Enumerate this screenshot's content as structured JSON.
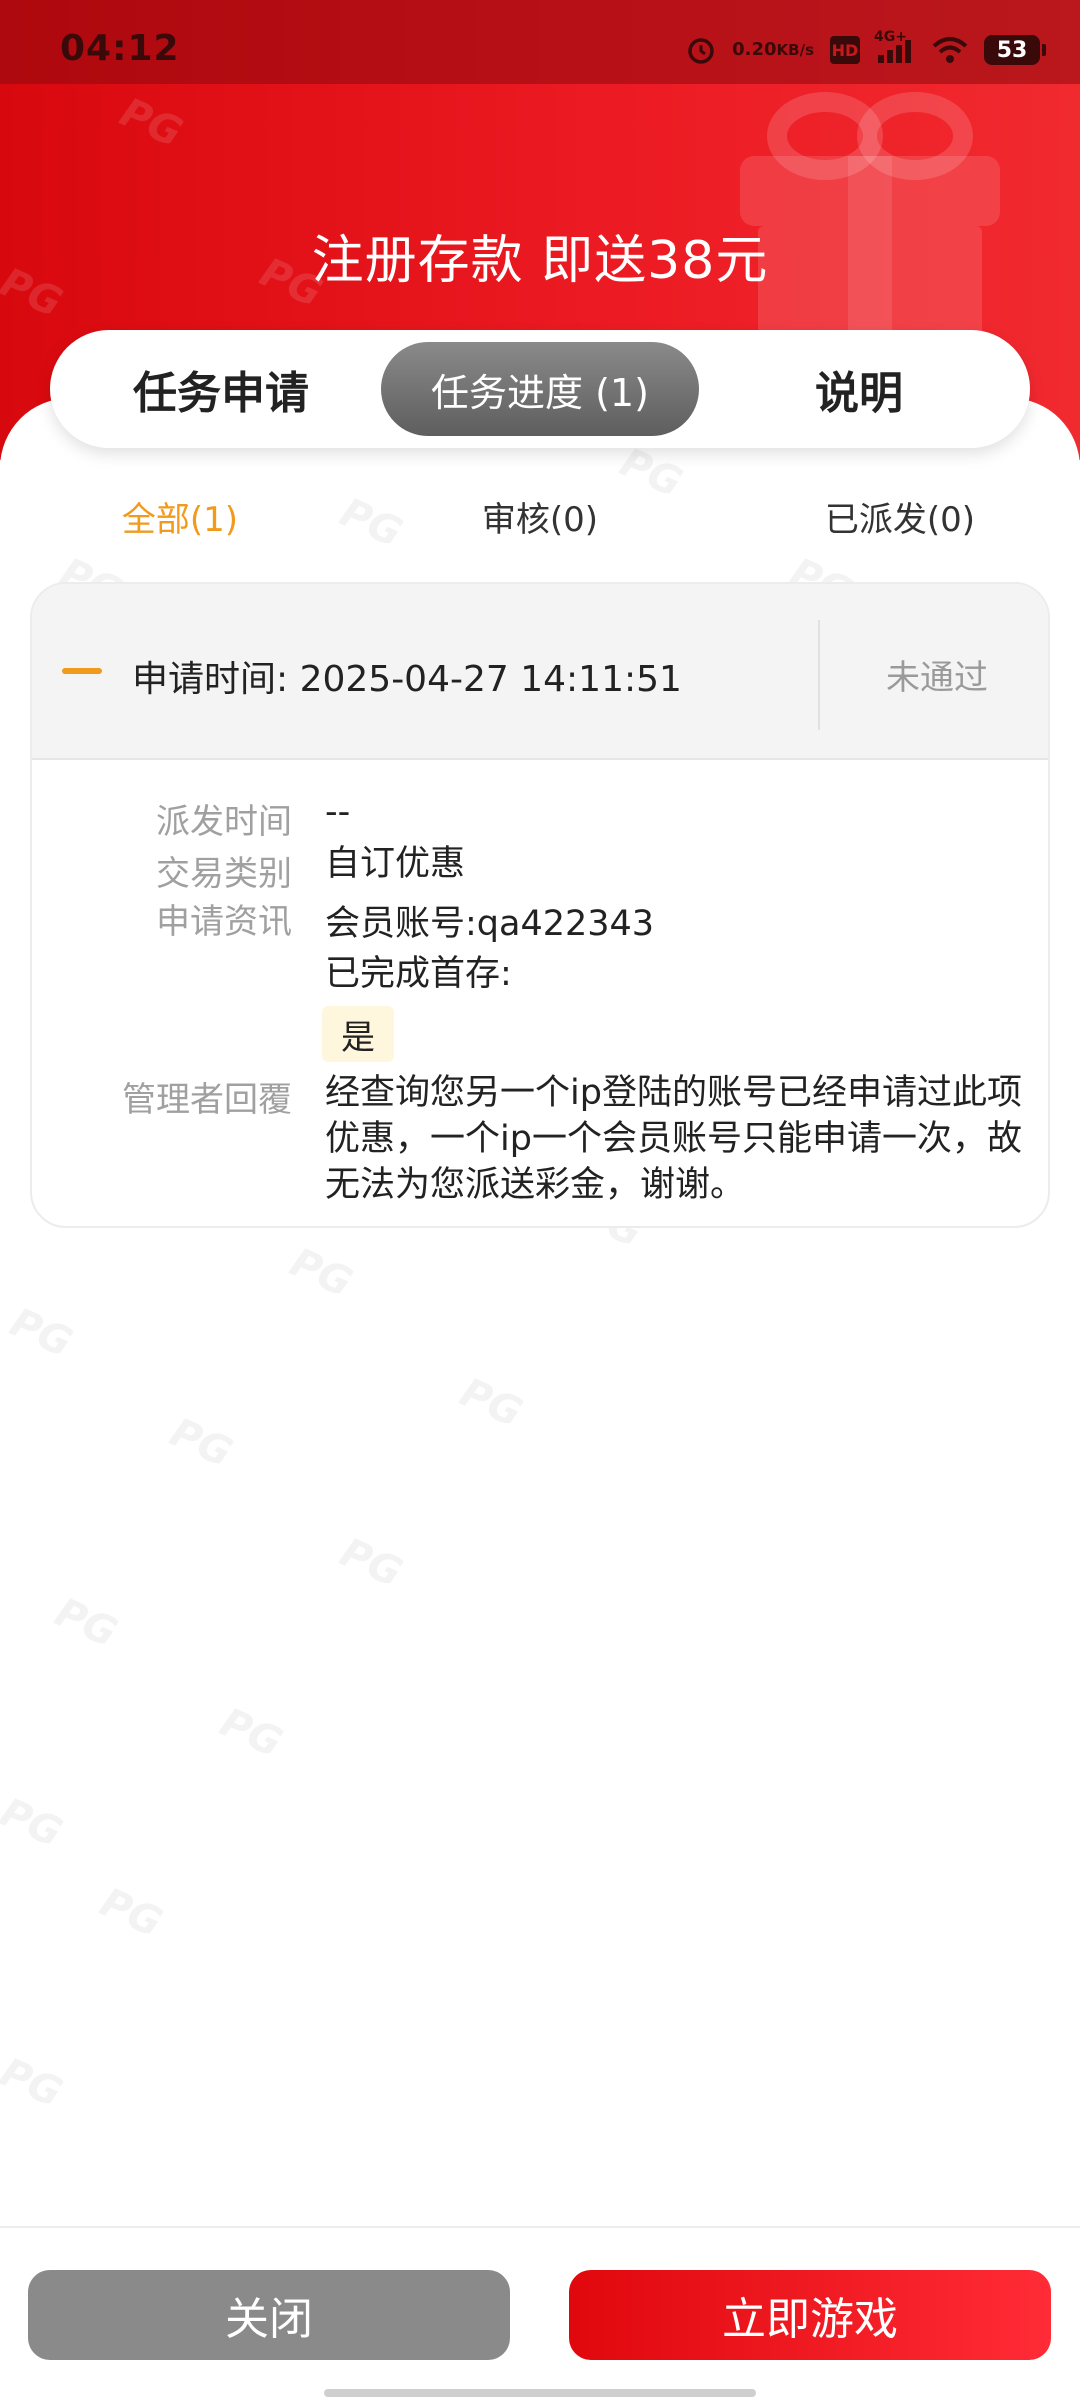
{
  "status_bar": {
    "time": "04:12",
    "net_speed_value": "0.20",
    "net_speed_unit": "KB/s",
    "hd": "HD",
    "network": "4G+",
    "battery": "53"
  },
  "header": {
    "title": "注册存款 即送38元"
  },
  "tabs": [
    {
      "label": "任务申请"
    },
    {
      "label": "任务进度 (1)",
      "active": true
    },
    {
      "label": "说明"
    }
  ],
  "filters": [
    {
      "label": "全部(1)",
      "active": true
    },
    {
      "label": "审核(0)"
    },
    {
      "label": "已派发(0)"
    }
  ],
  "record": {
    "apply_time_label": "申请时间: 2025-04-27 14:11:51",
    "status": "未通过",
    "fields": {
      "dispatch_time_label": "派发时间",
      "dispatch_time_value": "--",
      "trade_type_label": "交易类别",
      "trade_type_value": "自订优惠",
      "apply_info_label": "申请资讯",
      "member_account": "会员账号:qa422343",
      "first_deposit_label": "已完成首存:",
      "first_deposit_value": "是",
      "admin_reply_label": "管理者回覆",
      "admin_reply_value": "经查询您另一个ip登陆的账号已经申请过此项优惠，一个ip一个会员账号只能申请一次，故无法为您派送彩金，谢谢。"
    }
  },
  "footer": {
    "close_label": "关闭",
    "play_label": "立即游戏"
  },
  "colors": {
    "brand_red": "#e3111a",
    "accent_orange": "#f29a1c",
    "active_tab_gray": "#6e6e6e",
    "close_button_gray": "#8a8a8a"
  }
}
